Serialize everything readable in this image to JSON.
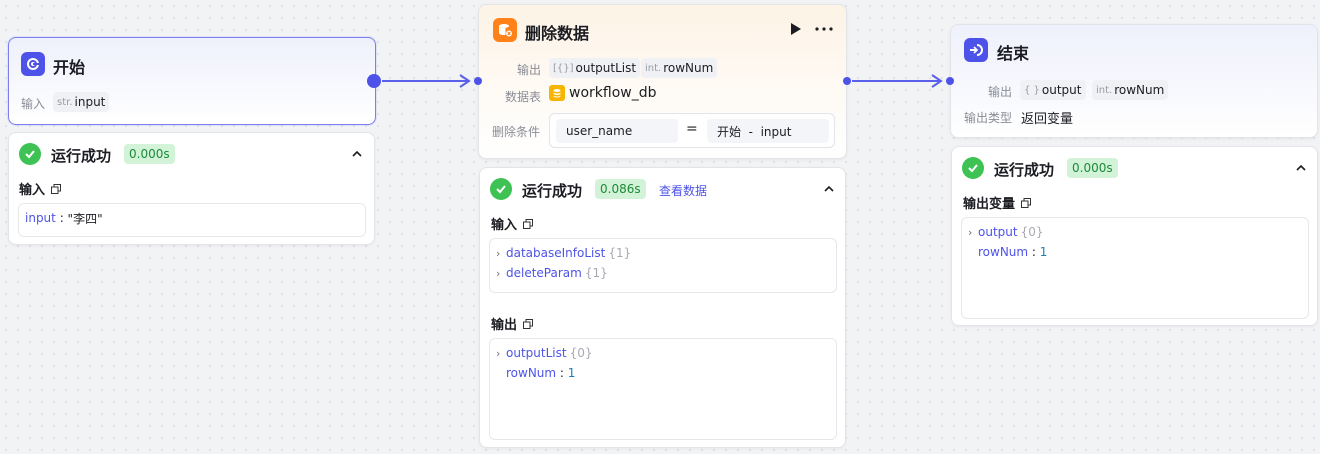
{
  "colors": {
    "accent": "#4d53e8",
    "success": "#3ec254",
    "success_badge_bg": "#d2f3d7",
    "db_icon": "#ff811a",
    "table_icon": "#f7b500"
  },
  "start_node": {
    "title": "开始",
    "icon": "start-icon",
    "input_label": "输入",
    "input_param": {
      "type": "str.",
      "name": "input"
    }
  },
  "start_result": {
    "status": "运行成功",
    "time": "0.000s",
    "input_section": "输入",
    "input_line": {
      "key": "input",
      "sep": " : ",
      "value": "\"李四\""
    }
  },
  "delete_node": {
    "title": "删除数据",
    "icon": "database-delete-icon",
    "output_label": "输出",
    "outputs": [
      {
        "type": "[{}]",
        "name": "outputList"
      },
      {
        "type": "int.",
        "name": "rowNum"
      }
    ],
    "table_label": "数据表",
    "table_name": "workflow_db",
    "condition_label": "删除条件",
    "condition": {
      "field": "user_name",
      "operator": "=",
      "value": "开始  -  input"
    }
  },
  "delete_result": {
    "status": "运行成功",
    "time": "0.086s",
    "view_data": "查看数据",
    "input_section": "输入",
    "input_lines": [
      {
        "key": "databaseInfoList",
        "count": "{1}"
      },
      {
        "key": "deleteParam",
        "count": "{1}"
      }
    ],
    "output_section": "输出",
    "output_lines": [
      {
        "key": "outputList",
        "count": "{0}"
      },
      {
        "key": "rowNum",
        "sep": " : ",
        "value": "1"
      }
    ]
  },
  "end_node": {
    "title": "结束",
    "icon": "end-icon",
    "output_label": "输出",
    "outputs": [
      {
        "type": "{ }",
        "name": "output"
      },
      {
        "type": "int.",
        "name": "rowNum"
      }
    ],
    "output_type_label": "输出类型",
    "output_type_value": "返回变量"
  },
  "end_result": {
    "status": "运行成功",
    "time": "0.000s",
    "section": "输出变量",
    "lines": [
      {
        "key": "output",
        "count": "{0}"
      },
      {
        "key": "rowNum",
        "sep": " : ",
        "value": "1"
      }
    ]
  }
}
